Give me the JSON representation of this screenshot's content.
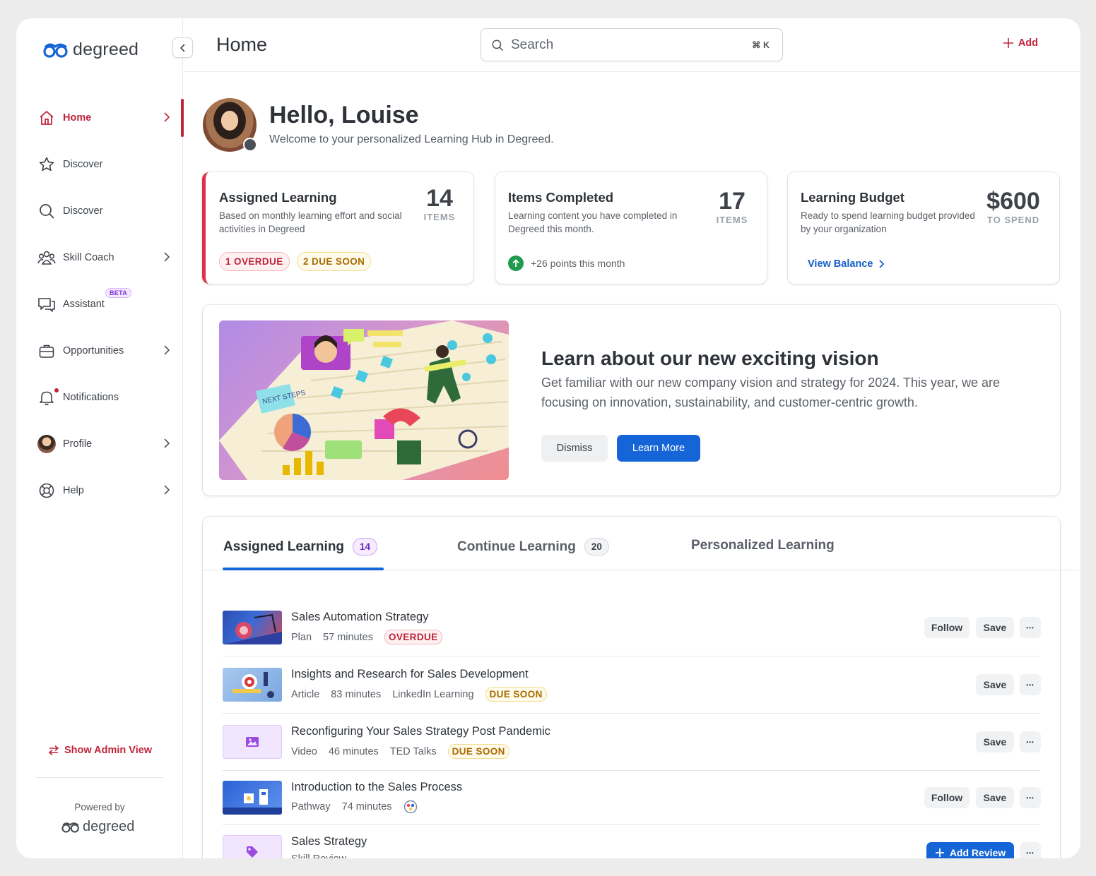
{
  "brand": {
    "name": "degreed",
    "accent": "#c0243b",
    "primary": "#1565d8"
  },
  "sidebar": {
    "items": [
      {
        "label": "Home",
        "icon": "home-icon",
        "active": true
      },
      {
        "label": "Discover",
        "icon": "star-icon"
      },
      {
        "label": "Discover",
        "icon": "search-icon"
      },
      {
        "label": "Skill Coach",
        "icon": "users-icon"
      },
      {
        "label": "Assistant",
        "icon": "chat-icon",
        "badge": "BETA"
      },
      {
        "label": "Opportunities",
        "icon": "briefcase-icon"
      },
      {
        "label": "Notifications",
        "icon": "bell-icon"
      },
      {
        "label": "Profile",
        "icon": "avatar"
      },
      {
        "label": "Help",
        "icon": "lifebuoy-icon"
      }
    ],
    "admin_view": "Show Admin View",
    "powered_by": "Powered by",
    "powered_brand": "degreed"
  },
  "header": {
    "title": "Home",
    "search_placeholder": "Search",
    "search_shortcut": "⌘ K",
    "add_label": "Add"
  },
  "greeting": {
    "hello": "Hello, Louise",
    "welcome": "Welcome to your personalized Learning Hub in Degreed."
  },
  "stats": {
    "assigned": {
      "title": "Assigned Learning",
      "desc": "Based on monthly learning effort and social activities in Degreed",
      "value": "14",
      "unit": "ITEMS",
      "overdue": "1 OVERDUE",
      "due_soon": "2 DUE SOON"
    },
    "completed": {
      "title": "Items Completed",
      "desc": "Learning content you have completed in Degreed this month.",
      "value": "17",
      "unit": "ITEMS",
      "points": "+26 points this month"
    },
    "budget": {
      "title": "Learning Budget",
      "desc": "Ready to spend learning budget provided by your organization",
      "value": "$600",
      "unit": "TO SPEND",
      "link": "View Balance"
    }
  },
  "banner": {
    "title": "Learn about our new exciting vision",
    "body": "Get familiar with our new company vision and strategy for 2024. This year, we are focusing on innovation, sustainability, and customer-centric growth.",
    "dismiss": "Dismiss",
    "learn_more": "Learn More",
    "image_note": "NEXT STEPS"
  },
  "tabs": [
    {
      "label": "Assigned Learning",
      "count": "14",
      "active": true
    },
    {
      "label": "Continue Learning",
      "count": "20"
    },
    {
      "label": "Personalized Learning",
      "count": ""
    }
  ],
  "items": [
    {
      "title": "Sales Automation Strategy",
      "type": "Plan",
      "duration": "57 minutes",
      "provider": "",
      "tag": "OVERDUE",
      "actions": [
        "Follow",
        "Save"
      ]
    },
    {
      "title": "Insights and Research for Sales Development",
      "type": "Article",
      "duration": "83 minutes",
      "provider": "LinkedIn Learning",
      "tag": "DUE SOON",
      "actions": [
        "Save"
      ]
    },
    {
      "title": "Reconfiguring Your Sales Strategy Post Pandemic",
      "type": "Video",
      "duration": "46 minutes",
      "provider": "TED Talks",
      "tag": "DUE SOON",
      "actions": [
        "Save"
      ]
    },
    {
      "title": "Introduction to the Sales Process",
      "type": "Pathway",
      "duration": "74 minutes",
      "provider": "",
      "tag": "",
      "actions": [
        "Follow",
        "Save"
      ]
    },
    {
      "title": "Sales Strategy",
      "type": "Skill Review",
      "duration": "",
      "provider": "",
      "tag": "",
      "actions": [
        "Add Review"
      ]
    }
  ]
}
